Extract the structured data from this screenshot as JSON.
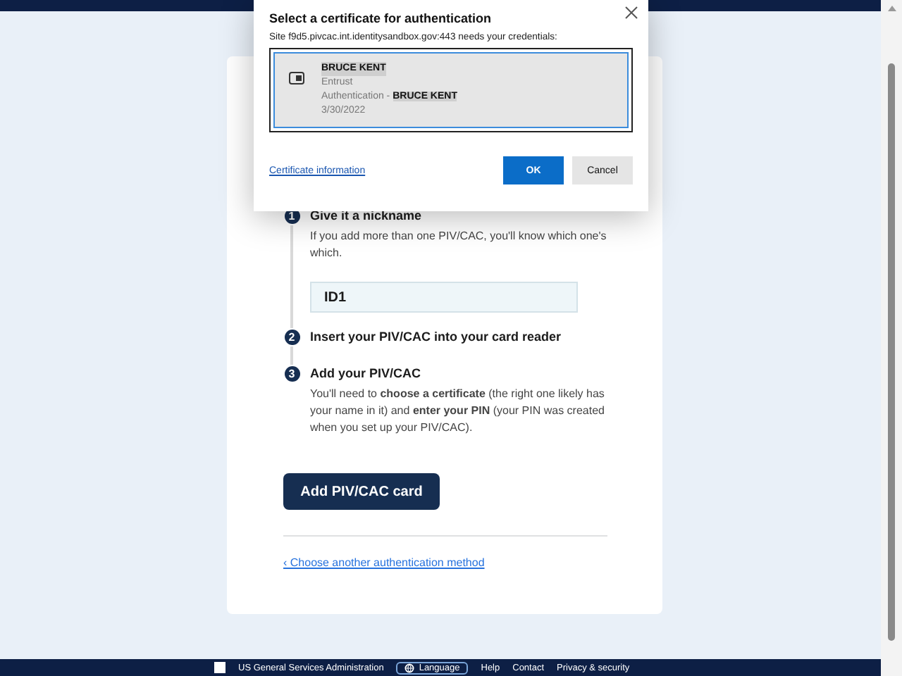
{
  "dialog": {
    "title": "Select a certificate for authentication",
    "site_text": "Site f9d5.pivcac.int.identitysandbox.gov:443 needs your credentials:",
    "certificates": [
      {
        "name": "BRUCE KENT",
        "issuer": "Entrust",
        "purpose": "Authentication - ",
        "purpose_name": "BRUCE KENT",
        "date": "3/30/2022",
        "selected": true
      }
    ],
    "info_link": "Certificate information",
    "buttons": [
      {
        "label": "OK",
        "kind": "primary"
      },
      {
        "label": "Cancel",
        "kind": "secondary"
      }
    ]
  },
  "steps": [
    {
      "number": "1",
      "title": "Give it a nickname",
      "description": "If you add more than one PIV/CAC, you'll know which one's which.",
      "field_value": "ID1"
    },
    {
      "number": "2",
      "title": "Insert your PIV/CAC into your card reader"
    },
    {
      "number": "3",
      "title": "Add your PIV/CAC",
      "description": "You'll need to **choose a certificate** (the right one likely has your name in it) and **enter your PIN** (your PIN was created when you set up your PIV/CAC)."
    }
  ],
  "add_button": "Add PIV/CAC card",
  "back_link": "‹ Choose another authentication method",
  "footer": {
    "agency": "US General Services Administration",
    "language": "Language",
    "links": [
      "Help",
      "Contact",
      "Privacy & security"
    ]
  }
}
